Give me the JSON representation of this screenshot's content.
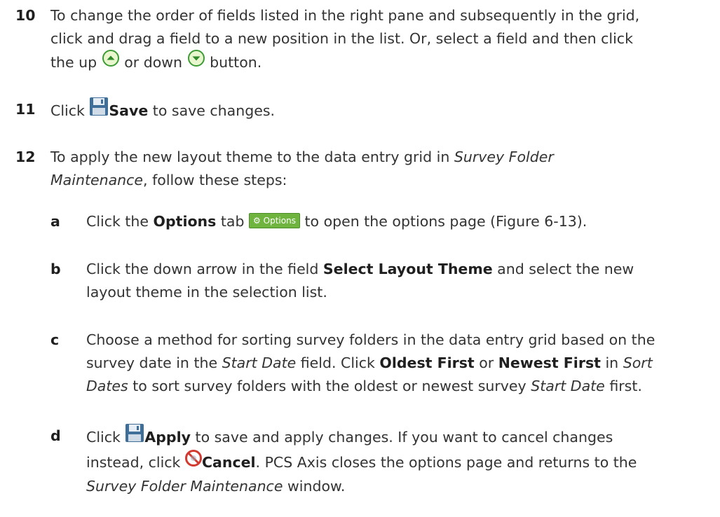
{
  "step10": {
    "num": "10",
    "line1": "To change the order of fields listed in the right pane and subsequently in the grid,",
    "line2": "click and drag a field to a new position in the list. Or, select a field and then click",
    "pre": "the up",
    "mid": "or down",
    "post": "button."
  },
  "step11": {
    "num": "11",
    "pre": "Click",
    "bold": "Save",
    "post": "to save changes."
  },
  "step12": {
    "num": "12",
    "pre": "To apply the new layout theme to the data entry grid in",
    "em1": "Survey Folder",
    "em2": "Maintenance",
    "post": ", follow these steps:"
  },
  "sub_a": {
    "num": "a",
    "pre": "Click the",
    "bold": "Options",
    "mid": "tab",
    "button_label": "Options",
    "post": "to open the options page (Figure 6-13)."
  },
  "sub_b": {
    "num": "b",
    "pre": "Click the down arrow in the field",
    "bold": "Select Layout Theme",
    "post1": "and select the new",
    "line2": "layout theme in the selection list."
  },
  "sub_c": {
    "num": "c",
    "line1": "Choose a method for sorting survey folders in the data entry grid based on the",
    "pre2": "survey date in the",
    "em1": "Start Date",
    "mid2": "field. Click",
    "bold1": "Oldest First",
    "or": "or",
    "bold2": "Newest First",
    "in": "in",
    "em2": "Sort",
    "em3": "Dates",
    "post3": "to sort survey folders with the oldest or newest survey",
    "em4": "Start Date",
    "end3": "first."
  },
  "sub_d": {
    "num": "d",
    "pre": "Click",
    "bold1": "Apply",
    "post1": "to save and apply changes. If you want to cancel changes",
    "pre2": "instead, click",
    "bold2": "Cancel",
    "post2": ". PCS Axis closes the options page and returns to the",
    "em": "Survey Folder Maintenance",
    "end": "window."
  }
}
